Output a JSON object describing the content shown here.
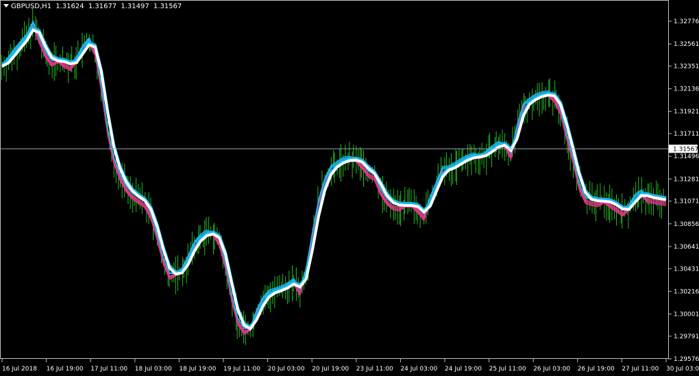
{
  "header": {
    "symbol": "GBPUSD,H1",
    "open": "1.31624",
    "high": "1.31677",
    "low": "1.31497",
    "close": "1.31567"
  },
  "colors": {
    "background": "#000000",
    "candle": "#22c020",
    "ma_cyan": "#19b6f0",
    "ma_pink": "#e8338a",
    "ma_white": "#ffffff",
    "price_line": "#9aa8b8"
  },
  "chart_data": {
    "type": "line",
    "symbol": "GBPUSD",
    "timeframe": "H1",
    "y_ticks": [
      "1.32776",
      "1.32561",
      "1.32351",
      "1.32136",
      "1.31921",
      "1.31711",
      "1.31496",
      "1.31281",
      "1.31071",
      "1.30856",
      "1.30641",
      "1.30431",
      "1.30216",
      "1.30001",
      "1.29791",
      "1.29576"
    ],
    "ylim": [
      1.29576,
      1.32776
    ],
    "current_price": "1.31567",
    "x_ticks": [
      "16 Jul 2018",
      "16 Jul 19:00",
      "17 Jul 11:00",
      "18 Jul 03:00",
      "18 Jul 19:00",
      "19 Jul 11:00",
      "20 Jul 03:00",
      "20 Jul 19:00",
      "23 Jul 11:00",
      "24 Jul 03:00",
      "24 Jul 19:00",
      "25 Jul 11:00",
      "26 Jul 03:00",
      "26 Jul 19:00",
      "27 Jul 11:00",
      "30 Jul 03:00"
    ],
    "x_range": [
      "16 Jul 2018",
      "30 Jul 03:00"
    ],
    "series_price": [
      1.3235,
      1.324,
      1.3248,
      1.3255,
      1.3262,
      1.3274,
      1.3262,
      1.3248,
      1.324,
      1.324,
      1.3239,
      1.3236,
      1.324,
      1.3251,
      1.3258,
      1.325,
      1.3216,
      1.3175,
      1.3148,
      1.3132,
      1.3121,
      1.3114,
      1.311,
      1.3106,
      1.3095,
      1.3075,
      1.3052,
      1.3038,
      1.3038,
      1.304,
      1.3052,
      1.3065,
      1.3072,
      1.3076,
      1.3076,
      1.307,
      1.3048,
      1.3017,
      1.2995,
      1.2986,
      1.2986,
      1.3,
      1.3012,
      1.3019,
      1.3021,
      1.3023,
      1.3026,
      1.303,
      1.3023,
      1.304,
      1.3074,
      1.3105,
      1.3125,
      1.3137,
      1.3141,
      1.3145,
      1.3146,
      1.3146,
      1.3143,
      1.3135,
      1.3132,
      1.3118,
      1.3109,
      1.3104,
      1.3103,
      1.3103,
      1.3103,
      1.3101,
      1.3094,
      1.3108,
      1.3122,
      1.3136,
      1.3137,
      1.314,
      1.3144,
      1.3147,
      1.3149,
      1.3149,
      1.3151,
      1.3156,
      1.316,
      1.316,
      1.3152,
      1.3176,
      1.3196,
      1.3201,
      1.3205,
      1.3207,
      1.3208,
      1.3206,
      1.3194,
      1.317,
      1.3148,
      1.3123,
      1.311,
      1.3108,
      1.3107,
      1.3107,
      1.3106,
      1.3102,
      1.3098,
      1.31,
      1.311,
      1.3114,
      1.3111,
      1.311,
      1.3109,
      1.3108
    ]
  }
}
